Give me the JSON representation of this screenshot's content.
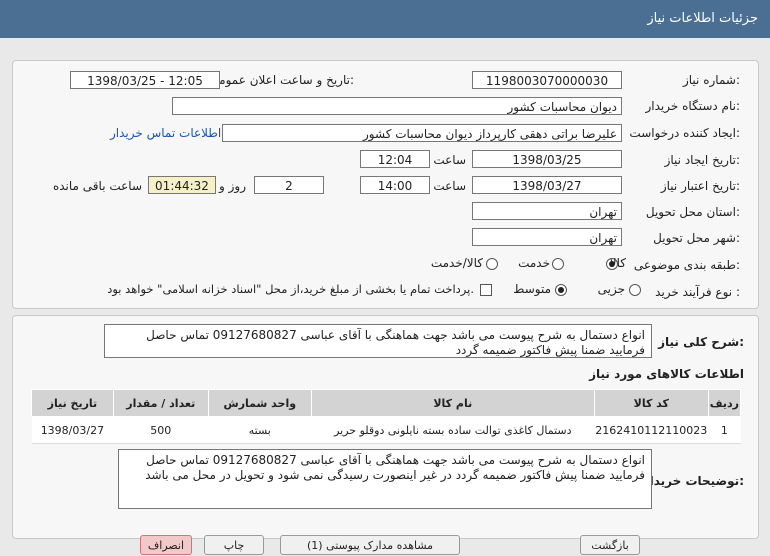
{
  "header": {
    "title": "جزئیات اطلاعات نیاز"
  },
  "form": {
    "need_number_label": "شماره نیاز:",
    "need_number": "1198003070000030",
    "announce_label": "تاریخ و ساعت اعلان عمومی:",
    "announce_value": "1398/03/25 - 12:05",
    "buyer_org_label": "نام دستگاه خریدار:",
    "buyer_org": "دیوان محاسبات کشور",
    "creator_label": "ایجاد کننده درخواست:",
    "creator": "علیرضا براتی دهقی کارپرداز دیوان محاسبات کشور",
    "contact_link": "اطلاعات تماس خریدار",
    "created_date_label": "تاریخ ایجاد نیاز:",
    "created_date": "1398/03/25",
    "time_label": "ساعت",
    "created_time": "12:04",
    "validity_label": "تاریخ اعتبار نیاز:",
    "validity_date": "1398/03/27",
    "validity_time": "14:00",
    "days": "2",
    "days_label": "روز و",
    "countdown": "01:44:32",
    "remaining_label": "ساعت باقی مانده",
    "province_label": "استان محل تحویل:",
    "province": "تهران",
    "city_label": "شهر محل تحویل:",
    "city": "تهران",
    "category_label": "طبقه بندی موضوعی:",
    "category_options": [
      "کالا",
      "خدمت",
      "کالا/خدمت"
    ],
    "category_selected": "کالا",
    "process_label": "نوع فرآیند خرید :",
    "process_options": [
      "جزیی",
      "متوسط"
    ],
    "process_selected": "متوسط",
    "payment_note": "پرداخت تمام یا بخشی از مبلغ خرید،از محل \"اسناد خزانه اسلامی\" خواهد بود."
  },
  "description": {
    "label": "شرح کلی نیاز:",
    "text": "انواع دستمال به شرح پیوست می باشد جهت هماهنگی با آقای عباسی 09127680827 تماس حاصل فرمایید ضمنا پیش فاکتور ضمیمه گردد"
  },
  "items": {
    "section_title": "اطلاعات کالاهای مورد نیاز",
    "columns": [
      "ردیف",
      "کد کالا",
      "نام کالا",
      "واحد شمارش",
      "تعداد / مقدار",
      "تاریخ نیاز"
    ],
    "rows": [
      [
        "1",
        "2162410112110023",
        "دستمال کاغذی توالت ساده بسته نایلونی دوقلو حریر",
        "بسته",
        "500",
        "1398/03/27"
      ]
    ]
  },
  "buyer_notes": {
    "label": "توضیحات خریدار:",
    "text": "انواع دستمال به شرح پیوست می باشد جهت هماهنگی با آقای عباسی 09127680827 تماس حاصل فرمایید ضمنا پیش فاکتور ضمیمه گردد در غیر اینصورت رسیدگی نمی شود و تحویل در محل می باشد"
  },
  "footer": {
    "buttons": [
      "بازگشت",
      "مشاهده مدارک پیوستی (1)",
      "چاپ",
      "انصراف"
    ]
  }
}
